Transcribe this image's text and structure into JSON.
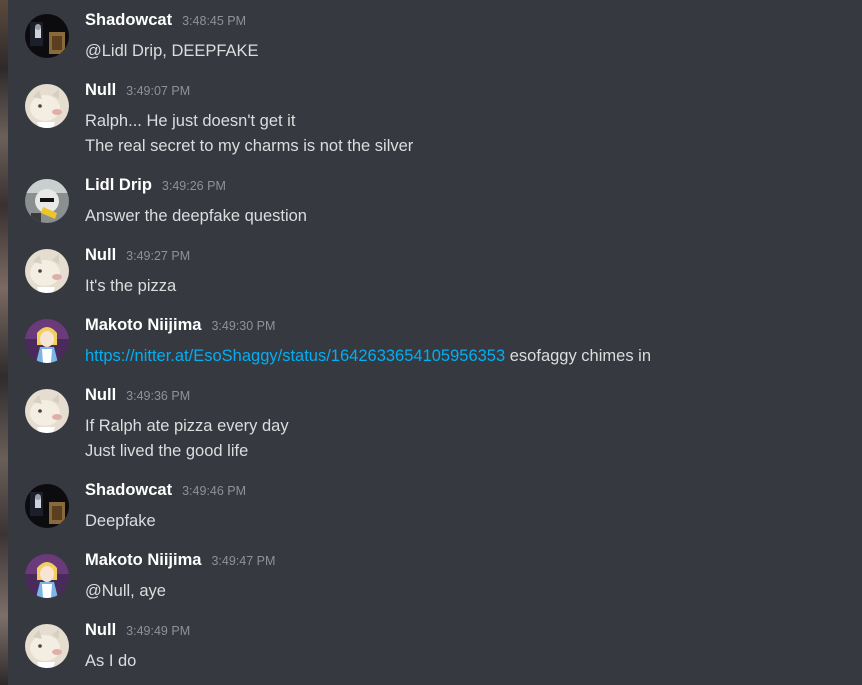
{
  "messages": [
    {
      "author": "Shadowcat",
      "avatar": "shadowcat-avatar",
      "time": "3:48:45 PM",
      "lines": [
        "@Lidl Drip, DEEPFAKE"
      ]
    },
    {
      "author": "Null",
      "avatar": "null-avatar",
      "time": "3:49:07 PM",
      "lines": [
        "Ralph... He just doesn't get it",
        "The real secret to my charms is not the silver"
      ]
    },
    {
      "author": "Lidl Drip",
      "avatar": "lidl-drip-avatar",
      "time": "3:49:26 PM",
      "lines": [
        "Answer the deepfake question"
      ]
    },
    {
      "author": "Null",
      "avatar": "null-avatar",
      "time": "3:49:27 PM",
      "lines": [
        "It's the pizza"
      ]
    },
    {
      "author": "Makoto Niijima",
      "avatar": "makoto-avatar",
      "time": "3:49:30 PM",
      "link": "https://nitter.at/EsoShaggy/status/1642633654105956353",
      "after_link": " esofaggy chimes in"
    },
    {
      "author": "Null",
      "avatar": "null-avatar",
      "time": "3:49:36 PM",
      "lines": [
        "If Ralph ate pizza every day",
        "Just lived the good life"
      ]
    },
    {
      "author": "Shadowcat",
      "avatar": "shadowcat-avatar",
      "time": "3:49:46 PM",
      "lines": [
        "Deepfake"
      ]
    },
    {
      "author": "Makoto Niijima",
      "avatar": "makoto-avatar",
      "time": "3:49:47 PM",
      "lines": [
        "@Null, aye"
      ]
    },
    {
      "author": "Null",
      "avatar": "null-avatar",
      "time": "3:49:49 PM",
      "lines": [
        "As I do"
      ]
    }
  ],
  "colors": {
    "background": "#36393f",
    "author": "#ffffff",
    "timestamp": "#8e9297",
    "text": "#dcddde",
    "link": "#00aff4"
  }
}
